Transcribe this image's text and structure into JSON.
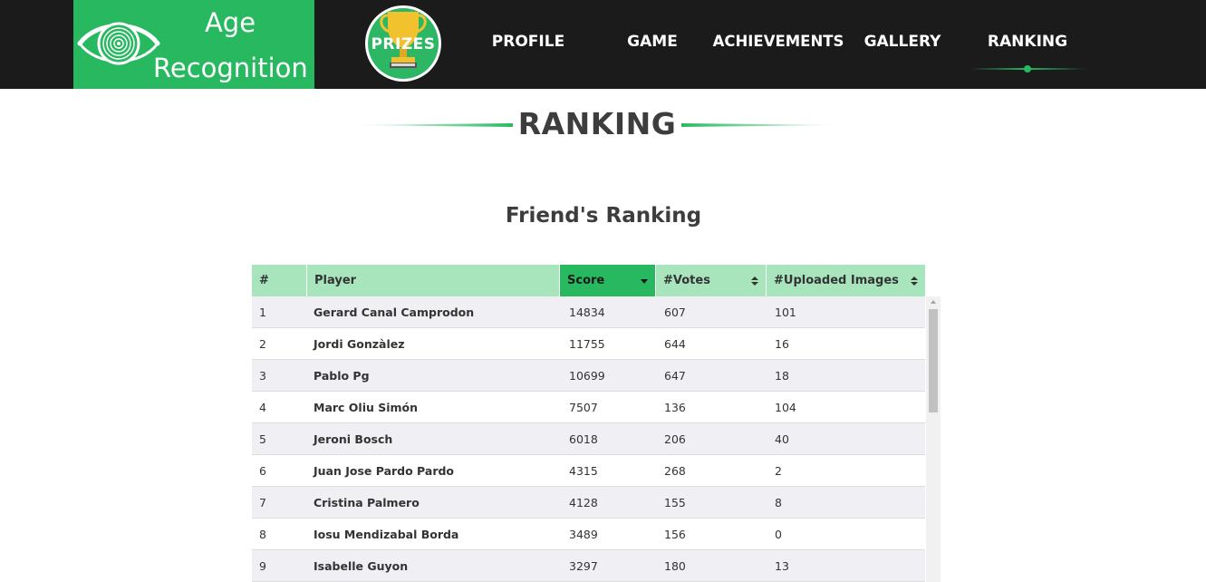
{
  "brand": {
    "name_line1": "Age",
    "name_line2": "Recognition",
    "color": "#27b860"
  },
  "prize_badge": {
    "label": "PRIZES",
    "icon": "trophy-icon"
  },
  "nav": {
    "items": [
      {
        "label": "PROFILE"
      },
      {
        "label": "GAME"
      },
      {
        "label": "ACHIEVEMENTS"
      },
      {
        "label": "GALLERY"
      },
      {
        "label": "RANKING",
        "active": true
      }
    ]
  },
  "page": {
    "title": "RANKING",
    "subtitle": "Friend's Ranking"
  },
  "table": {
    "headers": {
      "num": "#",
      "player": "Player",
      "score": "Score",
      "votes": "#Votes",
      "uploads": "#Uploaded Images"
    },
    "sorted_by": "Score",
    "rows": [
      {
        "num": "1",
        "player": "Gerard Canal Camprodon",
        "score": "14834",
        "votes": "607",
        "uploads": "101"
      },
      {
        "num": "2",
        "player": "Jordi Gonzàlez",
        "score": "11755",
        "votes": "644",
        "uploads": "16"
      },
      {
        "num": "3",
        "player": "Pablo Pg",
        "score": "10699",
        "votes": "647",
        "uploads": "18"
      },
      {
        "num": "4",
        "player": "Marc Oliu Simón",
        "score": "7507",
        "votes": "136",
        "uploads": "104"
      },
      {
        "num": "5",
        "player": "Jeroni Bosch",
        "score": "6018",
        "votes": "206",
        "uploads": "40"
      },
      {
        "num": "6",
        "player": "Juan Jose Pardo Pardo",
        "score": "4315",
        "votes": "268",
        "uploads": "2"
      },
      {
        "num": "7",
        "player": "Cristina Palmero",
        "score": "4128",
        "votes": "155",
        "uploads": "8"
      },
      {
        "num": "8",
        "player": "Iosu Mendizabal Borda",
        "score": "3489",
        "votes": "156",
        "uploads": "0"
      },
      {
        "num": "9",
        "player": "Isabelle Guyon",
        "score": "3297",
        "votes": "180",
        "uploads": "13"
      }
    ]
  },
  "colors": {
    "topbar": "#1b1b1b",
    "accent": "#27b860",
    "header_row": "#a8e5bd"
  }
}
